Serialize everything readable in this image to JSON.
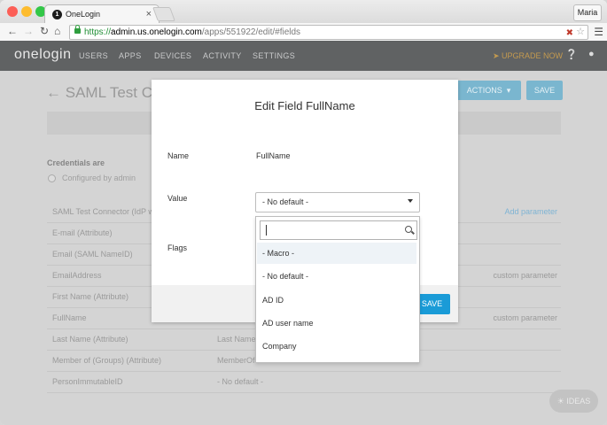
{
  "browser": {
    "tab_title": "OneLogin",
    "tab_favicon": "1",
    "tab_close": "×",
    "user_button": "Maria",
    "url_scheme": "https://",
    "url_host": "admin.us.onelogin.com",
    "url_path": "/apps/551922/edit/#fields"
  },
  "appnav": {
    "brand": "onelogin",
    "items": [
      "USERS",
      "APPS",
      "DEVICES",
      "ACTIVITY",
      "SETTINGS"
    ],
    "upgrade": "UPGRADE NOW"
  },
  "page": {
    "title": "SAML Test Con",
    "actions_label": "ACTIONS",
    "save_label": "SAVE",
    "credentials_title": "Credentials are",
    "credentials_option": "Configured by admin",
    "add_parameter": "Add parameter",
    "table": [
      {
        "name": "SAML Test Connector (IdP w",
        "value": "",
        "note": ""
      },
      {
        "name": "E-mail (Attribute)",
        "value": "",
        "note": ""
      },
      {
        "name": "Email (SAML NameID)",
        "value": "",
        "note": ""
      },
      {
        "name": "EmailAddress",
        "value": "",
        "note": "custom parameter"
      },
      {
        "name": "First Name (Attribute)",
        "value": "",
        "note": ""
      },
      {
        "name": "FullName",
        "value": "",
        "note": "custom parameter"
      },
      {
        "name": "Last Name (Attribute)",
        "value": "Last Name",
        "note": ""
      },
      {
        "name": "Member of (Groups) (Attribute)",
        "value": "MemberOf",
        "note": ""
      },
      {
        "name": "PersonImmutableID",
        "value": "- No default -",
        "note": ""
      }
    ],
    "ideas": "IDEAS"
  },
  "modal": {
    "title": "Edit Field FullName",
    "name_label": "Name",
    "name_value": "FullName",
    "value_label": "Value",
    "value_selected": "- No default -",
    "flags_label": "Flags",
    "save": "SAVE"
  },
  "dropdown": {
    "search_value": "",
    "options": [
      "- Macro -",
      "- No default -",
      "AD ID",
      "AD user name",
      "Company"
    ],
    "highlighted_index": 0
  }
}
